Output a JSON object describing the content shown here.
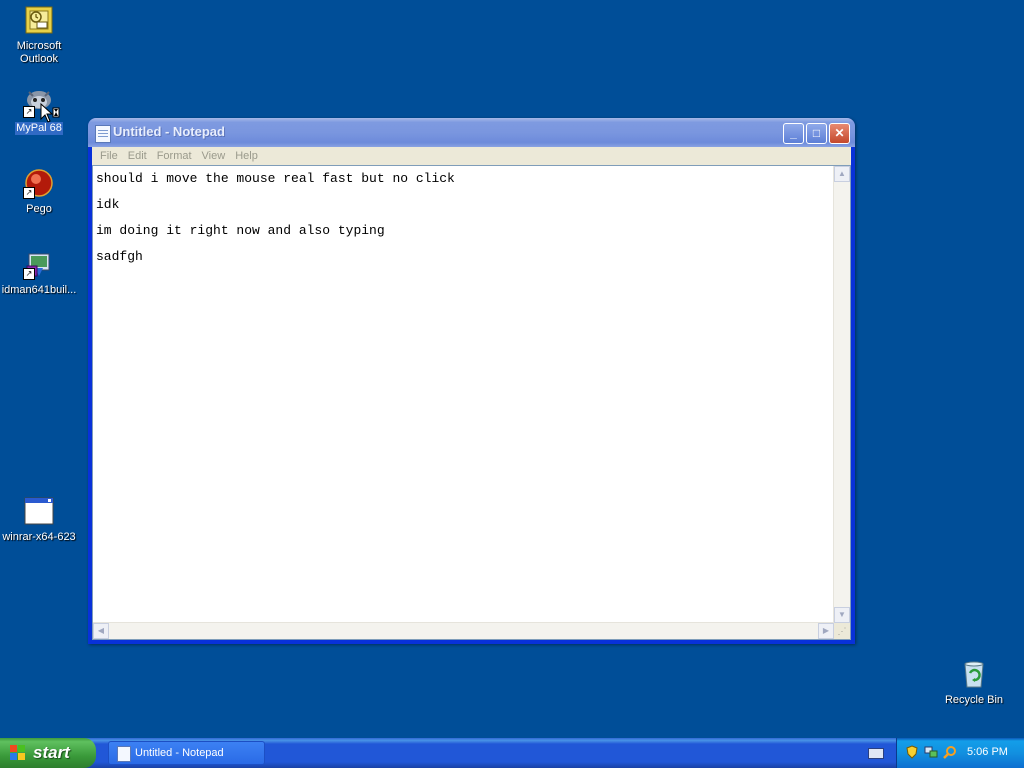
{
  "desktop": {
    "icons": [
      {
        "label": "Microsoft\nOutlook"
      },
      {
        "label": "MyPal 68"
      },
      {
        "label": "Pego"
      },
      {
        "label": "idman641buil..."
      },
      {
        "label": "winrar-x64-623"
      }
    ],
    "recycle_bin": {
      "label": "Recycle Bin"
    }
  },
  "notepad": {
    "title": "Untitled - Notepad",
    "menu": [
      "File",
      "Edit",
      "Format",
      "View",
      "Help"
    ],
    "content": "should i move the mouse real fast but no click\nidk\nim doing it right now and also typing\nsadfgh",
    "buttons": {
      "minimize": "_",
      "maximize": "□",
      "close": "✕"
    }
  },
  "taskbar": {
    "start_label": "start",
    "task_label": "Untitled - Notepad",
    "clock": "5:06 PM"
  },
  "colors": {
    "desktop_bg": "#004e98",
    "selection": "#316ac5"
  }
}
